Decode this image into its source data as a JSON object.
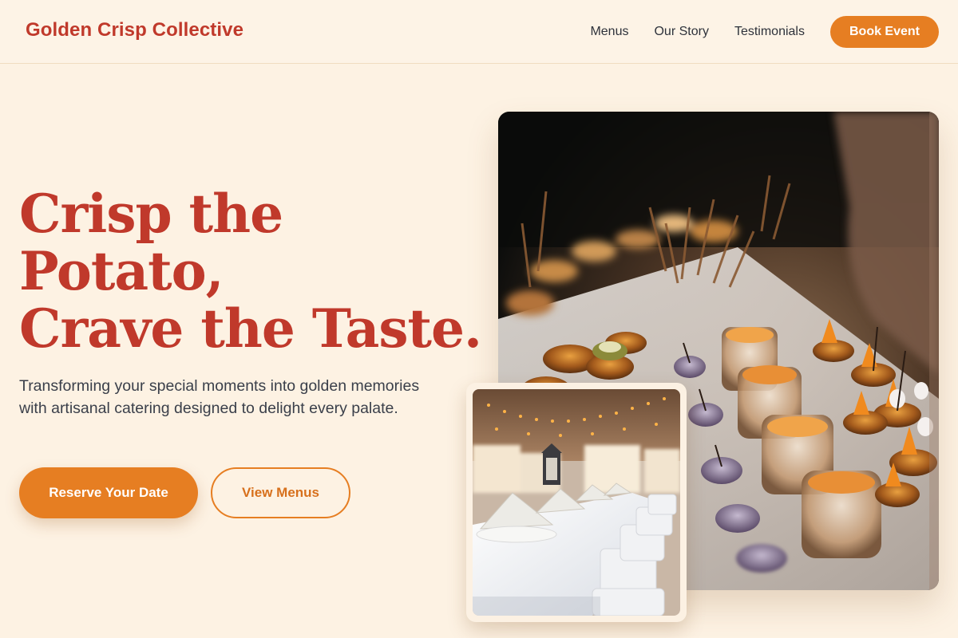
{
  "brand": {
    "name": "Golden Crisp Collective"
  },
  "nav": {
    "links": [
      "Menus",
      "Our Story",
      "Testimonials"
    ],
    "cta_label": "Book Event"
  },
  "hero": {
    "title_lines": [
      "Crisp the",
      "Potato,",
      "Crave the Taste."
    ],
    "subtitle": "Transforming your special moments into golden memories with artisanal catering designed to delight every palate.",
    "primary_label": "Reserve Your Date",
    "secondary_label": "View Menus"
  },
  "images": {
    "main": "catering-appetizers-photo",
    "secondary": "banquet-table-photo"
  },
  "colors": {
    "background": "#fdf2e3",
    "brand": "#c0392b",
    "accent": "#e67e22",
    "text": "#3a3f4a"
  }
}
